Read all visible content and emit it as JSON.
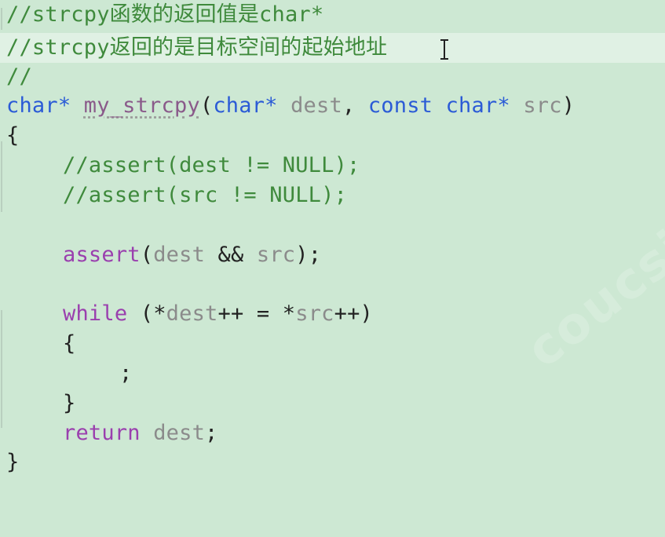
{
  "editor": {
    "lines": {
      "l1": {
        "comment": "//strcpy函数的返回值是char*"
      },
      "l2": {
        "comment": "//strcpy返回的是目标空间的起始地址"
      },
      "l3": {
        "comment": "//"
      },
      "l4": {
        "ret_type": "char*",
        "fn_name": "my_strcpy",
        "open_paren": "(",
        "p1_type": "char*",
        "p1_name": "dest",
        "comma": ",",
        "p2_const": "const",
        "p2_type": "char*",
        "p2_name": "src",
        "close_paren": ")"
      },
      "l5": {
        "brace": "{"
      },
      "l6": {
        "comment": "//assert(dest != NULL);"
      },
      "l7": {
        "comment": "//assert(src != NULL);"
      },
      "l9": {
        "fn": "assert",
        "open": "(",
        "a": "dest",
        "op": "&&",
        "b": "src",
        "close": ");"
      },
      "l11": {
        "kw": "while",
        "open": "(*",
        "a": "dest",
        "op1": "++ = *",
        "b": "src",
        "close": "++)"
      },
      "l12": {
        "brace": "{"
      },
      "l13": {
        "semi": ";"
      },
      "l14": {
        "brace": "}"
      },
      "l15": {
        "kw": "return",
        "var": "dest",
        "semi": ";"
      },
      "l16": {
        "brace": "}"
      }
    },
    "cursor_icon": "text-cursor-icon",
    "watermark_text": "coucsio"
  },
  "colors": {
    "background": "#cde8d3",
    "current_line": "#e0f1e4",
    "comment": "#3f8a3c",
    "keyword": "#2b5bd6",
    "control": "#9a3fae",
    "identifier": "#8b8b8b"
  }
}
